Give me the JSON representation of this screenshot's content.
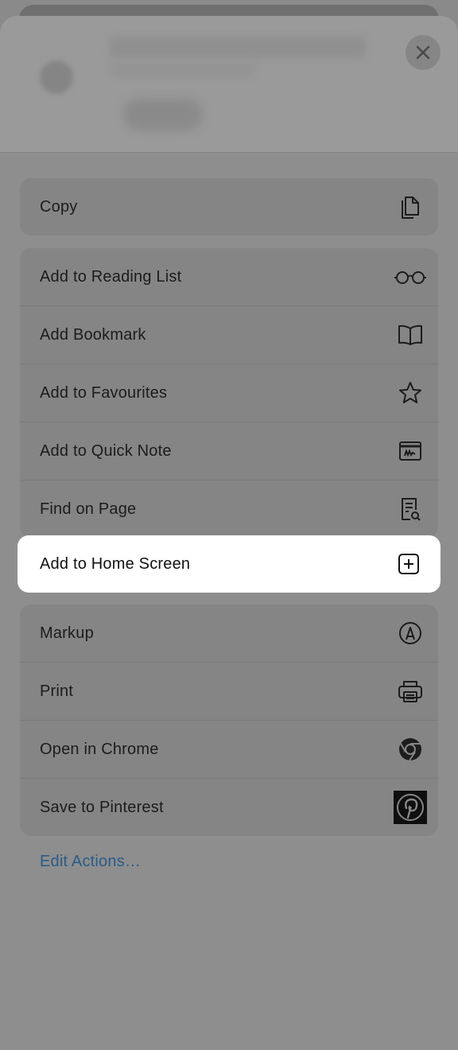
{
  "close_label": "×",
  "groups": [
    {
      "items": [
        {
          "label": "Copy",
          "icon": "copy-icon"
        }
      ]
    },
    {
      "items": [
        {
          "label": "Add to Reading List",
          "icon": "glasses-icon"
        },
        {
          "label": "Add Bookmark",
          "icon": "book-icon"
        },
        {
          "label": "Add to Favourites",
          "icon": "star-icon"
        },
        {
          "label": "Add to Quick Note",
          "icon": "quick-note-icon"
        },
        {
          "label": "Find on Page",
          "icon": "find-on-page-icon"
        }
      ]
    },
    {
      "items": [
        {
          "label": "Add to Home Screen",
          "icon": "add-square-icon",
          "highlighted": true
        }
      ]
    },
    {
      "items": [
        {
          "label": "Markup",
          "icon": "markup-icon"
        },
        {
          "label": "Print",
          "icon": "printer-icon"
        },
        {
          "label": "Open in Chrome",
          "icon": "chrome-icon"
        },
        {
          "label": "Save to Pinterest",
          "icon": "pinterest-icon"
        }
      ]
    }
  ],
  "edit_actions": "Edit Actions…"
}
